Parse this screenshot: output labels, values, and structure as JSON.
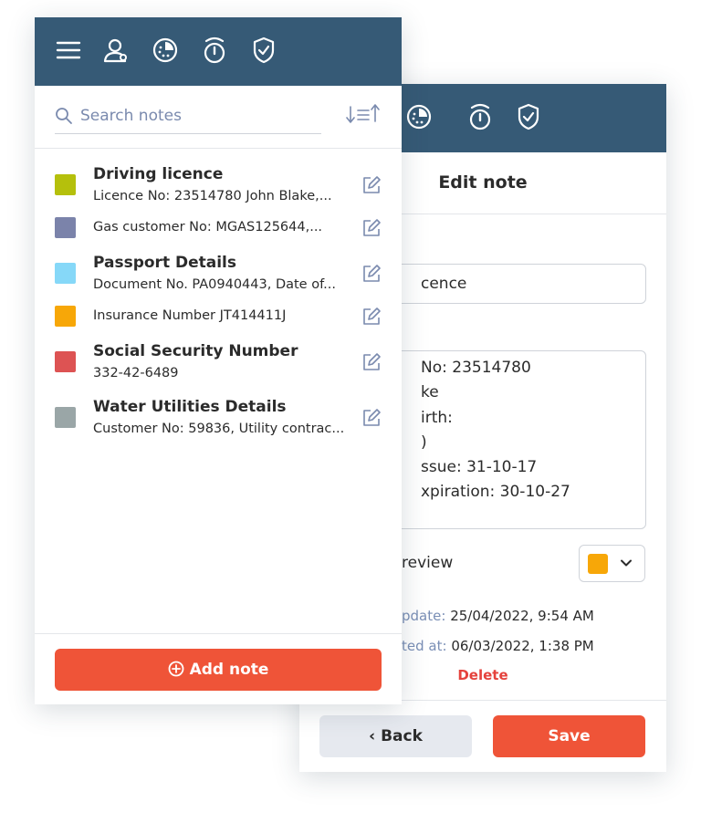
{
  "app": {
    "nav_icons": [
      "menu-icon",
      "profile-icon",
      "dashboard-icon",
      "timer-icon",
      "shield-icon"
    ],
    "colors": {
      "header": "#365a76",
      "accent": "#ef5438",
      "delete": "#e5423c",
      "meta_key": "#7a8fb6"
    }
  },
  "notes_list": {
    "search": {
      "placeholder": "Search notes",
      "value": ""
    },
    "notes": [
      {
        "title": "Driving licence",
        "body": "Licence No: 23514780 John Blake,...",
        "color": "#b5c00c"
      },
      {
        "title": "",
        "body": "Gas customer No: MGAS125644,...",
        "color": "#7b83aa"
      },
      {
        "title": "Passport Details",
        "body": "Document No. PA0940443, Date of...",
        "color": "#86d8f8"
      },
      {
        "title": "",
        "body": "Insurance Number JT414411J",
        "color": "#f7a708"
      },
      {
        "title": "Social Security Number",
        "body": "332-42-6489",
        "color": "#dd5353"
      },
      {
        "title": "Water Utilities Details",
        "body": "Customer No: 59836, Utility contrac...",
        "color": "#9aa6a7"
      }
    ],
    "add_button_label": "Add note"
  },
  "edit_note": {
    "header_title": "Edit note",
    "title_value_visible": "cence",
    "body_lines_visible": [
      "No: 23514780",
      "ke",
      "irth:",
      ")",
      "ssue: 31-10-17",
      "xpiration: 30-10-27"
    ],
    "preview_label_visible": "review",
    "selected_color": "#f7a708",
    "last_update_key_visible": "pdate:",
    "last_update_value": "25/04/2022, 9:54 AM",
    "created_key_visible": "ted at:",
    "created_value": "06/03/2022, 1:38 PM",
    "delete_label": "Delete",
    "back_label": "Back",
    "save_label": "Save"
  }
}
